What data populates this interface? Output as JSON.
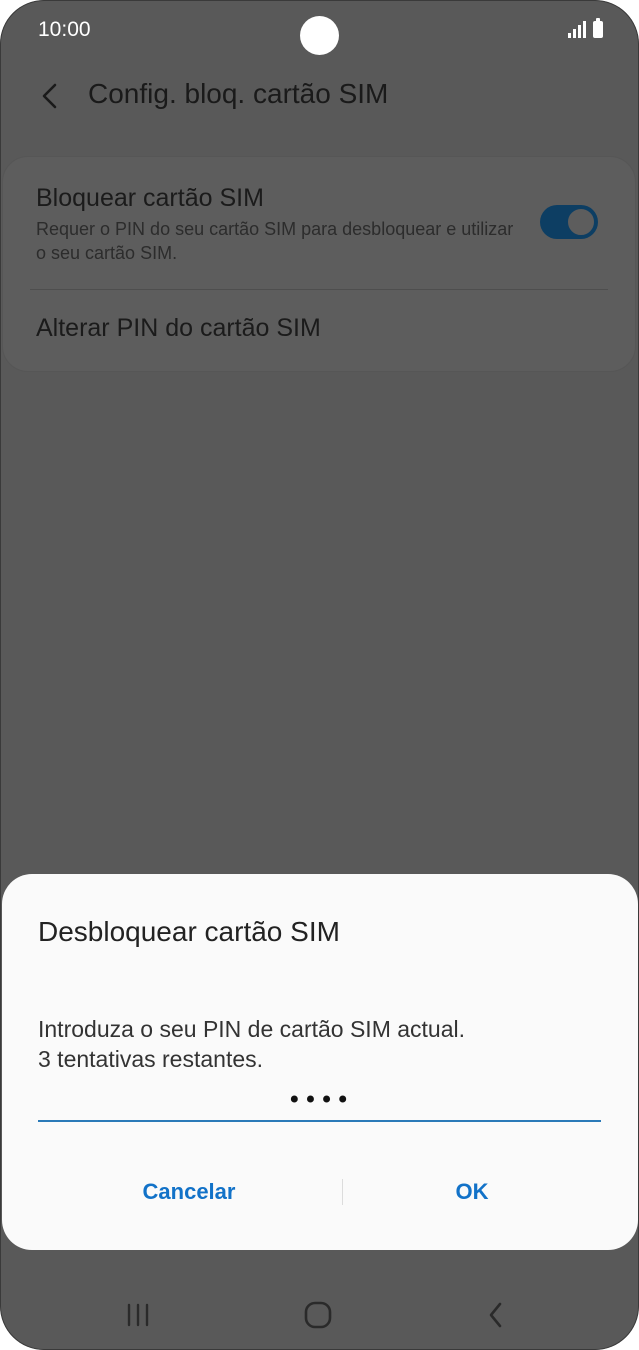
{
  "status_bar": {
    "time": "10:00"
  },
  "header": {
    "title": "Config. bloq. cartão SIM",
    "back_icon": "chevron-left-icon"
  },
  "settings": {
    "lock_sim": {
      "title": "Bloquear cartão SIM",
      "subtitle": "Requer o PIN do seu cartão SIM para desbloquear e utilizar o seu cartão SIM.",
      "enabled": true
    },
    "change_pin": {
      "title": "Alterar PIN do cartão SIM"
    }
  },
  "dialog": {
    "title": "Desbloquear cartão SIM",
    "message_line1": "Introduza o seu PIN de cartão SIM actual.",
    "message_line2": "3 tentativas restantes.",
    "pin_value": "••••",
    "cancel_label": "Cancelar",
    "ok_label": "OK"
  },
  "colors": {
    "accent": "#1272c8",
    "toggle_on": "#0d3e63",
    "scrim": "#595959",
    "dialog_bg": "#fafafa"
  },
  "nav_bar": {
    "recents_icon": "recents-icon",
    "home_icon": "home-icon",
    "back_icon": "back-icon"
  }
}
